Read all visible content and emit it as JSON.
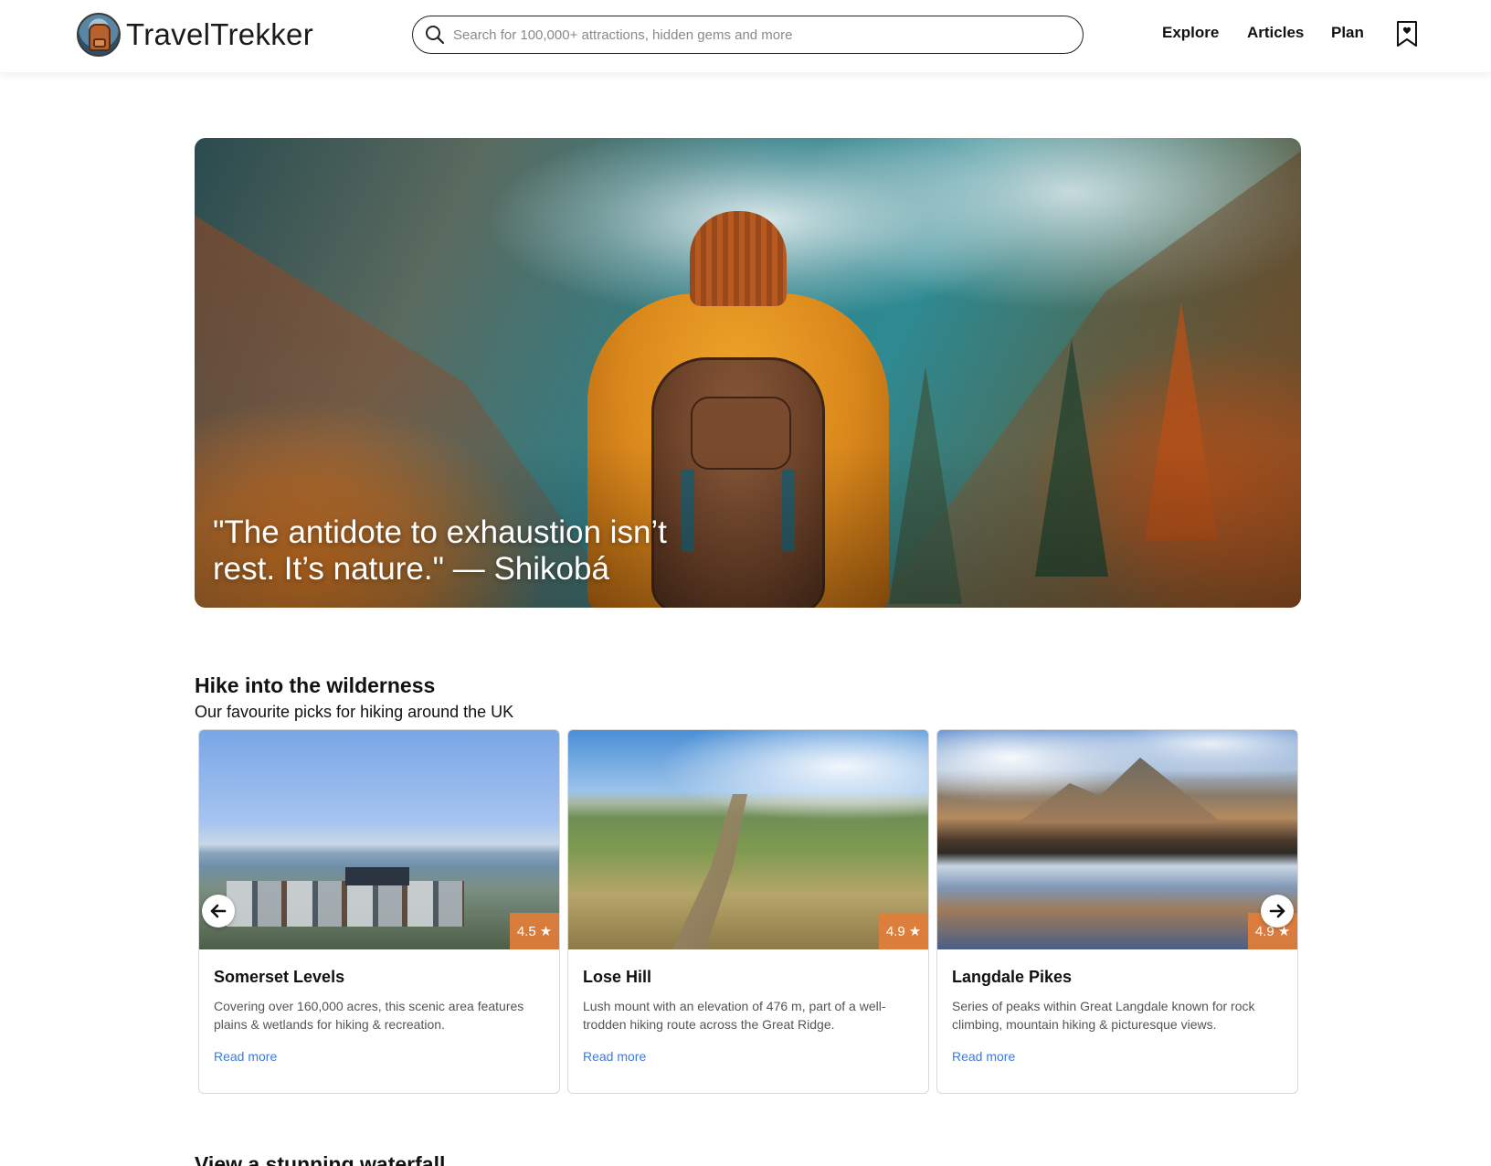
{
  "brand": {
    "name": "TravelTrekker"
  },
  "search": {
    "placeholder": "Search for 100,000+ attractions, hidden gems and more",
    "value": ""
  },
  "nav": {
    "explore": "Explore",
    "articles": "Articles",
    "plan": "Plan"
  },
  "hero": {
    "quote": "\"The antidote to exhaustion isn’t rest. It’s nature.\" — Shikobá"
  },
  "section": {
    "title": "Hike into the wilderness",
    "subtitle": "Our favourite picks for hiking around the UK"
  },
  "cards": [
    {
      "title": "Somerset Levels",
      "rating": "4.5",
      "description": "Covering over 160,000 acres, this scenic area features plains & wetlands for hiking & recreation.",
      "link": "Read more"
    },
    {
      "title": "Lose Hill",
      "rating": "4.9",
      "description": "Lush mount with an elevation of 476 m, part of a well-trodden hiking route across the Great Ridge.",
      "link": "Read more"
    },
    {
      "title": "Langdale Pikes",
      "rating": "4.9",
      "description": "Series of peaks within Great Langdale known for rock climbing, mountain hiking & picturesque views.",
      "link": "Read more"
    }
  ],
  "next_section": {
    "title": "View a stunning waterfall"
  },
  "icons": {
    "search": "search-icon",
    "bookmark": "bookmark-heart-icon",
    "star": "star-icon",
    "prev": "arrow-left-icon",
    "next": "arrow-right-icon"
  },
  "colors": {
    "rating_badge": "#e27e3a",
    "link": "#3b7bd9"
  }
}
